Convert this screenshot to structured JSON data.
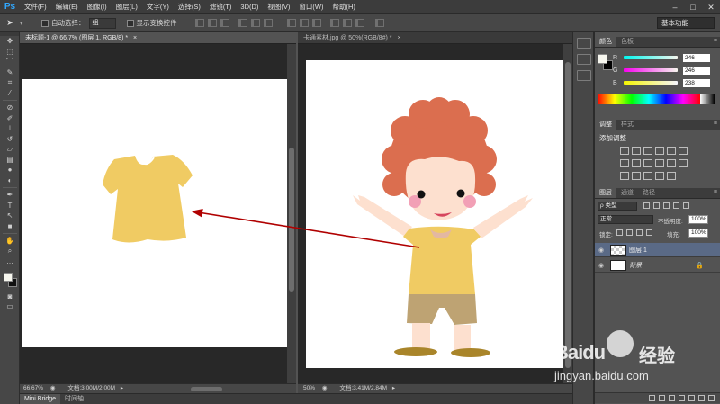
{
  "app": {
    "logo": "Ps"
  },
  "menu": [
    "文件(F)",
    "编辑(E)",
    "图像(I)",
    "图层(L)",
    "文字(Y)",
    "选择(S)",
    "滤镜(T)",
    "3D(D)",
    "视图(V)",
    "窗口(W)",
    "帮助(H)"
  ],
  "window_controls": {
    "minimize": "–",
    "maximize": "□",
    "close": "✕"
  },
  "options": {
    "auto_select_label": "自动选择：",
    "auto_select_value": "组",
    "show_transform_label": "显示变换控件",
    "workspace": "基本功能"
  },
  "documents": [
    {
      "tab": "未标题-1 @ 66.7% (图层 1, RGB/8) *",
      "zoom": "66.67%",
      "doc_info": "文档:3.00M/2.00M"
    },
    {
      "tab": "卡通素材.jpg @ 50%(RGB/8#) *",
      "zoom": "50%",
      "doc_info": "文档:3.41M/2.84M"
    }
  ],
  "color_panel": {
    "tabs": [
      "颜色",
      "色板"
    ],
    "r_label": "R",
    "r_value": "246",
    "g_label": "G",
    "g_value": "246",
    "b_label": "B",
    "b_value": "238",
    "foreground": "#f6f6ee",
    "background": "#000000"
  },
  "adjust_panel": {
    "tabs": [
      "调整",
      "样式"
    ],
    "title": "添加调整"
  },
  "layers_panel": {
    "tabs": [
      "图层",
      "通道",
      "路径"
    ],
    "filter": "ρ 类型",
    "blend_mode": "正常",
    "opacity_label": "不透明度:",
    "opacity_value": "100%",
    "lock_label": "锁定:",
    "fill_label": "填充:",
    "fill_value": "100%",
    "layers": [
      {
        "name": "图层 1",
        "selected": true
      },
      {
        "name": "背景",
        "selected": false
      }
    ]
  },
  "bottom_tabs": [
    "Mini Bridge",
    "时间轴"
  ],
  "watermark": {
    "brand": "Baidu",
    "brand_cn": "经验",
    "url": "jingyan.baidu.com"
  },
  "colors": {
    "shirt": "#f0cb63",
    "hair": "#db6e4f",
    "arrow": "#b00000",
    "shorts": "#bea373",
    "skin": "#fde0cf"
  }
}
